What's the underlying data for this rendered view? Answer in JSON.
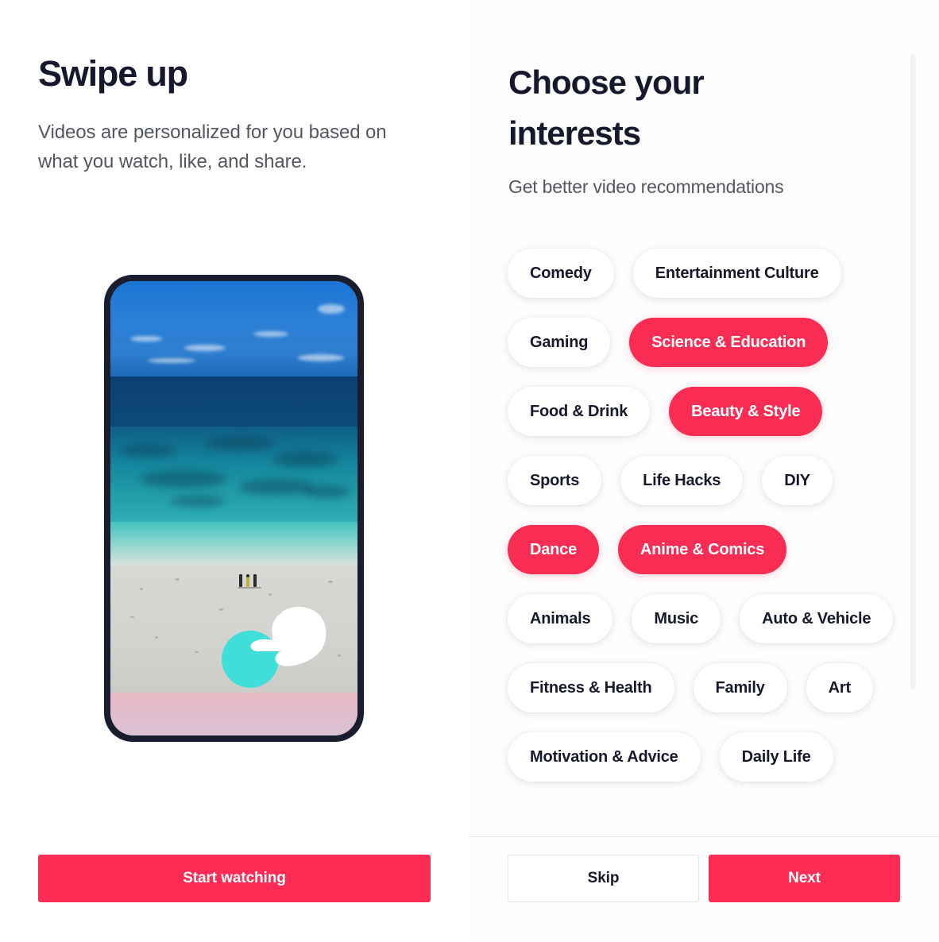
{
  "colors": {
    "accent": "#FE2C55",
    "chip_selected": "#F92C54",
    "text_primary": "#16182B",
    "text_secondary": "#53575F",
    "phone_frame": "#191D2D",
    "gesture_dot": "#3FDED8",
    "page_background": "#FFFFFF"
  },
  "left": {
    "title": "Swipe up",
    "subtitle": "Videos are personalized for you based on what you watch, like, and share.",
    "phone_preview": {
      "icon_name": "phone-mockup",
      "video_description": "Aerial beach video with blue sky, turquoise ocean and white sand",
      "gesture_icon_name": "swipe-up-hand-icon"
    },
    "cta_label": "Start watching"
  },
  "right": {
    "title": "Choose your interests",
    "subtitle": "Get better video recommendations",
    "interests": [
      {
        "label": "Comedy",
        "selected": false
      },
      {
        "label": "Entertainment Culture",
        "selected": false
      },
      {
        "label": "Gaming",
        "selected": false
      },
      {
        "label": "Science & Education",
        "selected": true
      },
      {
        "label": "Food & Drink",
        "selected": false
      },
      {
        "label": "Beauty & Style",
        "selected": true
      },
      {
        "label": "Sports",
        "selected": false
      },
      {
        "label": "Life Hacks",
        "selected": false
      },
      {
        "label": "DIY",
        "selected": false
      },
      {
        "label": "Dance",
        "selected": true
      },
      {
        "label": "Anime & Comics",
        "selected": true
      },
      {
        "label": "Animals",
        "selected": false
      },
      {
        "label": "Music",
        "selected": false
      },
      {
        "label": "Auto & Vehicle",
        "selected": false
      },
      {
        "label": "Fitness & Health",
        "selected": false
      },
      {
        "label": "Family",
        "selected": false
      },
      {
        "label": "Art",
        "selected": false
      },
      {
        "label": "Motivation & Advice",
        "selected": false
      },
      {
        "label": "Daily Life",
        "selected": false
      }
    ],
    "selected_count": 4,
    "skip_label": "Skip",
    "next_label": "Next"
  }
}
